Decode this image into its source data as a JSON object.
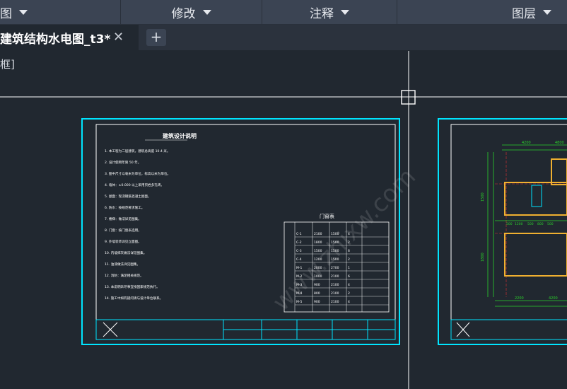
{
  "ribbon": {
    "panels": [
      {
        "label": "图"
      },
      {
        "label": "修改"
      },
      {
        "label": "注释"
      },
      {
        "label": "图层"
      }
    ]
  },
  "tabs": {
    "active_title": "建筑结构水电图_t3*",
    "close_glyph": "✕",
    "add_glyph": "+"
  },
  "viewport": {
    "label": "框]"
  },
  "drawing": {
    "sheet1": {
      "title": "建筑设计说明",
      "door_table_title": "门窗表",
      "note_lines": [
        "1. 本工程为二层建筑，建筑总高度 10.4 米。",
        "2. 设计使用年限 50 年。",
        "3. 图中尺寸以毫米为单位，标高以米为单位。",
        "4. 墙体：±0.000 以上采用页岩多孔砖。",
        "5. 屋面：现浇钢筋混凝土屋面。",
        "6. 防水：按规范要求施工。",
        "7. 楼梯：做法详见图集。",
        "8. 门窗：按门窗表选用。",
        "9. 外墙装饰详见立面图。",
        "10. 内墙抹灰做法详见图集。",
        "11. 油漆做法详见图集。",
        "12. 消防：满足相关规范。",
        "13. 本说明未尽事宜按国家规范执行。",
        "14. 施工中如有疑问请与设计单位联系。"
      ],
      "table_rows": [
        [
          "C-1",
          "2100",
          "1500",
          "4",
          ""
        ],
        [
          "C-2",
          "1800",
          "1500",
          "2",
          ""
        ],
        [
          "C-3",
          "1500",
          "1500",
          "6",
          ""
        ],
        [
          "C-4",
          "1200",
          "1500",
          "2",
          ""
        ],
        [
          "M-1",
          "2000",
          "2700",
          "1",
          ""
        ],
        [
          "M-2",
          "1000",
          "2100",
          "6",
          ""
        ],
        [
          "M-3",
          "900",
          "2100",
          "4",
          ""
        ],
        [
          "M-4",
          "800",
          "2100",
          "2",
          ""
        ],
        [
          "M-5",
          "900",
          "2100",
          "4",
          ""
        ]
      ]
    },
    "sheet2": {
      "dims_top": [
        "4200",
        "4800"
      ],
      "dims_mid": [
        "500",
        "1200",
        "500",
        "800",
        "500"
      ],
      "dims_bottom": [
        "2200",
        "4200"
      ],
      "dims_left": [
        "1500",
        "1800"
      ]
    },
    "watermark": "www.zhixw.com"
  },
  "colors": {
    "canvas_bg": "#212830",
    "ribbon_bg": "#3b4453",
    "sheet_frame": "#00e5ff",
    "drawing_white": "#ffffff",
    "dim_green": "#2bd12b",
    "wall_orange": "#f0b030",
    "axis_red": "#e03030"
  }
}
